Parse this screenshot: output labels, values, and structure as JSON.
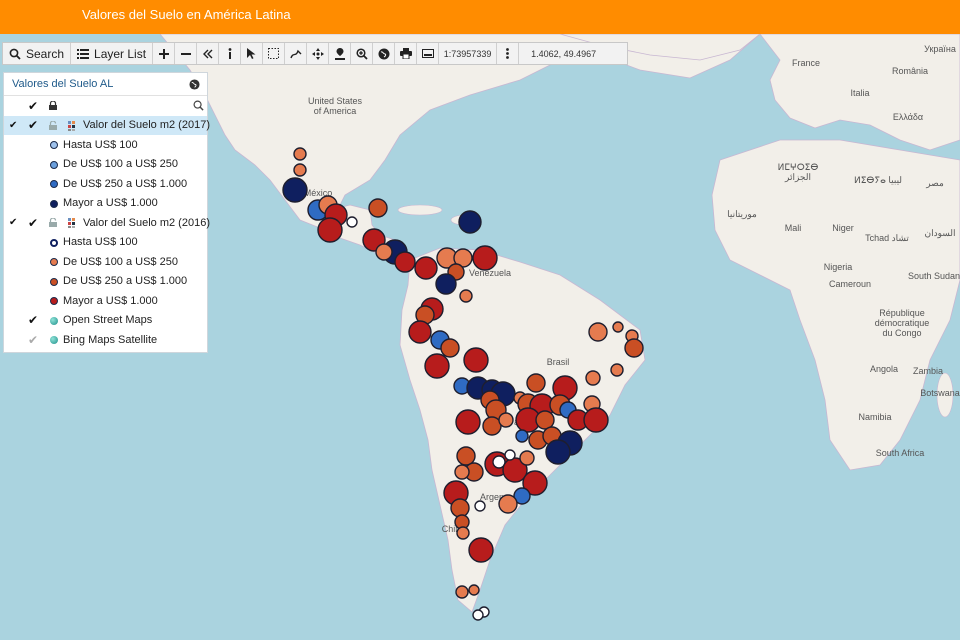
{
  "app": {
    "title": "Valores del Suelo en América Latina"
  },
  "toolbar": {
    "search_label": "Search",
    "layerlist_label": "Layer List",
    "scale": "1:73957339",
    "coords": "1.4062, 49.4967",
    "icons": [
      "search-icon",
      "list-icon",
      "zoom-in-icon",
      "zoom-out-icon",
      "collapse-icon",
      "info-icon",
      "pointer-icon",
      "select-box-icon",
      "measure-icon",
      "pan-icon",
      "location-icon",
      "zoom-icon",
      "globe-icon",
      "print-icon",
      "screen-icon",
      "more-icon"
    ]
  },
  "panel": {
    "title": "Valores del Suelo AL",
    "layer2017": {
      "name": "Valor del Suelo m2 (2017)",
      "legend": [
        {
          "label": "Hasta US$ 100",
          "color": "#9fc2ec"
        },
        {
          "label": "De US$ 100 a US$ 250",
          "color": "#6b9fdc"
        },
        {
          "label": "De US$ 250 a US$ 1.000",
          "color": "#2f6bc3"
        },
        {
          "label": "Mayor a US$ 1.000",
          "color": "#0f1f5f"
        }
      ]
    },
    "layer2016": {
      "name": "Valor del Suelo m2 (2016)",
      "legend": [
        {
          "label": "Hasta US$ 100",
          "color": "#ffffff"
        },
        {
          "label": "De US$ 100 a US$ 250",
          "color": "#e57b4f"
        },
        {
          "label": "De US$ 250 a US$ 1.000",
          "color": "#c94f24"
        },
        {
          "label": "Mayor a US$ 1.000",
          "color": "#b71c1c"
        }
      ]
    },
    "basemaps": [
      {
        "label": "Open Street Maps",
        "checked": true
      },
      {
        "label": "Bing Maps Satellite",
        "checked": false
      }
    ]
  },
  "map_labels": {
    "us": [
      "United States",
      "of America"
    ],
    "mexico": "México",
    "venezuela": "Venezuela",
    "brasil": "Brasil",
    "paraguay": "Parag",
    "argentina": "Argen",
    "chile": "Chile",
    "france": "France",
    "ukraine": "Україна",
    "romania": "România",
    "italia": "Italia",
    "greece": "Ελλάδα",
    "morocco": "ⵍⵎⵖⵔⵉⴱ",
    "algeria": "الجزائر",
    "libya": "ⵍⵉⴱⵢⴰ ليبيا",
    "egypt": "مصر",
    "mauritania": "موريتانيا",
    "mali": "Mali",
    "niger": "Niger",
    "tchad": "Tchad تشاد",
    "sudan": "السودان",
    "nigeria": "Nigeria",
    "south_sudan": "South Sudan",
    "cameroon": "Cameroun",
    "drc": [
      "République",
      "démocratique",
      "du Congo"
    ],
    "angola": "Angola",
    "zambia": "Zambia",
    "namibia": "Namibia",
    "botswana": "Botswana",
    "south_africa": "South Africa"
  }
}
